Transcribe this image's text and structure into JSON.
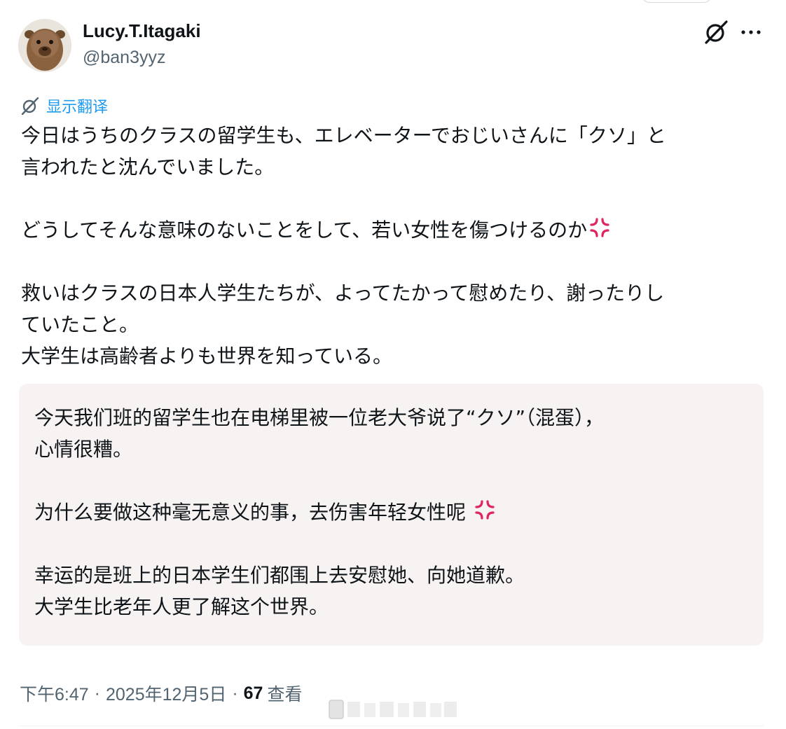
{
  "author": {
    "name": "Lucy.T.Itagaki",
    "handle": "@ban3yyz"
  },
  "icons": {
    "grok": "grok-icon",
    "more": "more-options-icon",
    "translate": "translate-icon",
    "anger": "anger-symbol-emoji"
  },
  "translate_label": "显示翻译",
  "tweet": {
    "line1": "今日はうちのクラスの留学生も、エレベーターでおじいさんに「クソ」と",
    "line2": "言われたと沈んでいました。",
    "line3": "どうしてそんな意味のないことをして、若い女性を傷つけるのか",
    "line4": "救いはクラスの日本人学生たちが、よってたかって慰めたり、謝ったりし",
    "line5": "ていたこと。",
    "line6": "大学生は高齢者よりも世界を知っている。"
  },
  "translation": {
    "line1": "今天我们班的留学生也在电梯里被一位老大爷说了“クソ”（混蛋），",
    "line2": "心情很糟。",
    "line3": "为什么要做这种毫无意义的事，去伤害年轻女性呢",
    "line4": "幸运的是班上的日本学生们都围上去安慰她、向她道歉。",
    "line5": "大学生比老年人更了解这个世界。"
  },
  "meta": {
    "time": "下午6:47",
    "separator": "·",
    "date": "2025年12月5日",
    "views_count": "67",
    "views_label": "查看"
  },
  "colors": {
    "link": "#1d9bf0",
    "secondary_text": "#536471",
    "primary_text": "#0f1419",
    "translation_bg": "#f7f3f2",
    "anger": "#e0245e"
  }
}
